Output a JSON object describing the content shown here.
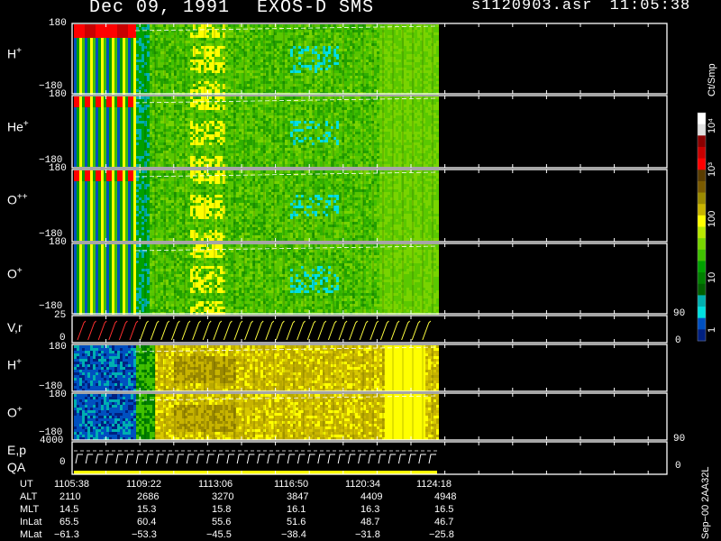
{
  "header": {
    "date": "Dec 09, 1991",
    "mission": "EXOS-D SMS",
    "file": "s1120903.asr",
    "time": "11:05:38"
  },
  "panels": [
    {
      "label": "H",
      "sup": "+",
      "ymax": "180",
      "ymin": "−180"
    },
    {
      "label": "He",
      "sup": "+",
      "ymax": "180",
      "ymin": "−180"
    },
    {
      "label": "O",
      "sup": "++",
      "ymax": "180",
      "ymin": "−180"
    },
    {
      "label": "O",
      "sup": "+",
      "ymax": "180",
      "ymin": "−180"
    },
    {
      "label": "V,r",
      "sup": "",
      "ymax": "25",
      "ymin": "0",
      "right_top": "90",
      "right_bottom": "0"
    },
    {
      "label": "H",
      "sup": "+",
      "ymax": "180",
      "ymin": "−180"
    },
    {
      "label": "O",
      "sup": "+",
      "ymax": "180",
      "ymin": "−180"
    },
    {
      "label": "E,p",
      "label2": "QA",
      "ymax": "4000",
      "ymin": "0",
      "right_top": "90",
      "right_bottom": "0"
    }
  ],
  "colorbar": {
    "title": "Ct/Smp",
    "ticks": [
      "10⁴",
      "10³",
      "100",
      "10",
      "1"
    ],
    "colors": [
      "#ffffff",
      "#e0e0e0",
      "#8b0000",
      "#c80000",
      "#ff0000",
      "#5a3c00",
      "#7a5a00",
      "#9b8a00",
      "#c8b400",
      "#ffff00",
      "#b8e800",
      "#78d400",
      "#40c000",
      "#00a000",
      "#008000",
      "#006000",
      "#00b0b0",
      "#00e0e0",
      "#0050c0",
      "#002080"
    ]
  },
  "footer": {
    "version": "Sep−00 2AA32L",
    "rows": [
      {
        "label": "UT",
        "values": [
          "1105:38",
          "1109:22",
          "1113:06",
          "1116:50",
          "1120:34",
          "1124:18"
        ]
      },
      {
        "label": "ALT",
        "values": [
          "2110",
          "2686",
          "3270",
          "3847",
          "4409",
          "4948"
        ]
      },
      {
        "label": "MLT",
        "values": [
          "14.5",
          "15.3",
          "15.8",
          "16.1",
          "16.3",
          "16.5"
        ]
      },
      {
        "label": "InLat",
        "values": [
          "65.5",
          "60.4",
          "55.6",
          "51.6",
          "48.7",
          "46.7"
        ]
      },
      {
        "label": "MLat",
        "values": [
          "−61.3",
          "−53.3",
          "−45.5",
          "−38.4",
          "−31.8",
          "−25.8"
        ]
      }
    ]
  },
  "chart_data": {
    "type": "heatmap",
    "title": "Dec 09, 1991   EXOS-D SMS",
    "x": [
      "1105:38",
      "1109:22",
      "1113:06",
      "1116:50",
      "1120:34",
      "1124:18"
    ],
    "xlabel": "UT",
    "ylim": [
      -180,
      180
    ],
    "colorbar_label": "Ct/Smp",
    "colorbar_scale": "log",
    "colorbar_range": [
      1,
      10000
    ],
    "series": [
      {
        "name": "H+",
        "ylim": [
          -180,
          180
        ]
      },
      {
        "name": "He+",
        "ylim": [
          -180,
          180
        ]
      },
      {
        "name": "O++",
        "ylim": [
          -180,
          180
        ]
      },
      {
        "name": "O+",
        "ylim": [
          -180,
          180
        ]
      },
      {
        "name": "V,r",
        "ylim": [
          0,
          25
        ]
      },
      {
        "name": "H+",
        "ylim": [
          -180,
          180
        ]
      },
      {
        "name": "O+",
        "ylim": [
          -180,
          180
        ]
      },
      {
        "name": "E,p",
        "ylim": [
          0,
          4000
        ]
      }
    ]
  }
}
